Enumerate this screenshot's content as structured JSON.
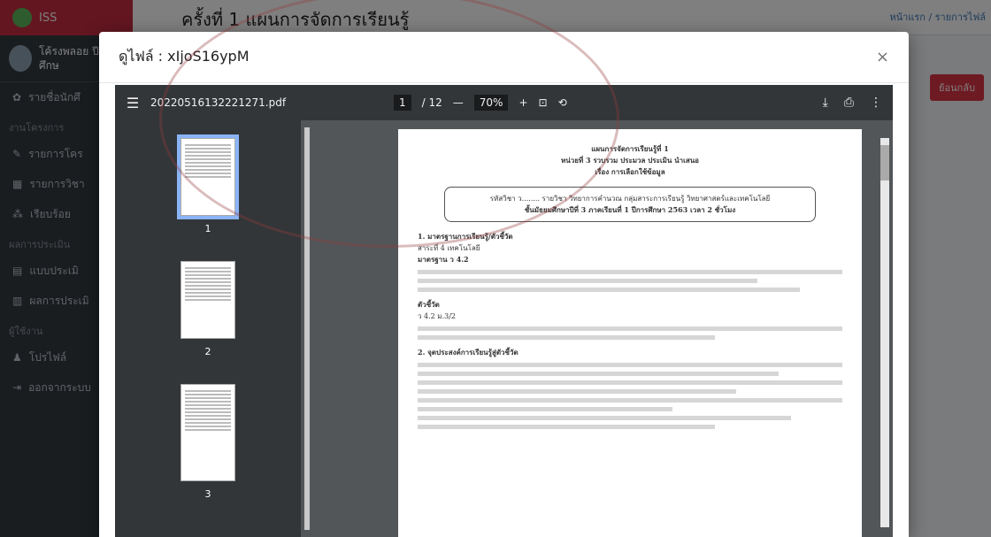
{
  "app": {
    "brand": "ISS",
    "user_name": "โค้รงพลอย ปีการศึกษ",
    "page_heading": "ครั้งที่ 1 แผนการจัดการเรียนรู้",
    "breadcrumb": "หน้าแรก / รายการไฟล์",
    "back_button": "ย้อนกลับ",
    "sidebar": {
      "item_students": "รายชื่อนักศึ",
      "section_work": "งานโครงการ",
      "item_projects": "รายการโคร",
      "item_schedule": "รายการวิชา",
      "item_tree": "เรียบร้อย",
      "section_eval": "ผลการประเมิน",
      "item_eval1": "แบบประเมิ",
      "item_eval2": "ผลการประเมิ",
      "section_user": "ผู้ใช้งาน",
      "item_profile": "โปรไฟล์",
      "item_logout": "ออกจากระบบ"
    }
  },
  "modal": {
    "title": "ดูไฟล์ : xIjoS16ypM",
    "close": "×"
  },
  "pdf": {
    "filename": "20220516132221271.pdf",
    "page_current": "1",
    "page_total": "/ 12",
    "zoom": "70%",
    "thumbs": [
      "1",
      "2",
      "3"
    ],
    "doc": {
      "title": "แผนการจัดการเรียนรู้ที่ 1",
      "unit": "หน่วยที่ 3 รวบรวม ประมวล ประเมิน นำเสนอ",
      "topic": "เรื่อง การเลือกใช้ข้อมูล",
      "box_line1": "รหัสวิชา ว........ รายวิชา วิทยาการคำนวณ กลุ่มสาระการเรียนรู้ วิทยาศาสตร์และเทคโนโลยี",
      "box_line2": "ชั้นมัธยมศึกษาปีที่ 3 ภาคเรียนที่ 1 ปีการศึกษา 2563 เวลา 2 ชั่วโมง",
      "sec1": "1. มาตรฐานการเรียนรู้/ตัวชี้วัด",
      "strand": "สาระที่ 4 เทคโนโลยี",
      "standard": "มาตรฐาน ว 4.2",
      "indicator_head": "ตัวชี้วัด",
      "indicator": "ว 4.2 ม.3/2",
      "sec2": "2. จุดประสงค์การเรียนรู้สู่ตัวชี้วัด"
    }
  }
}
